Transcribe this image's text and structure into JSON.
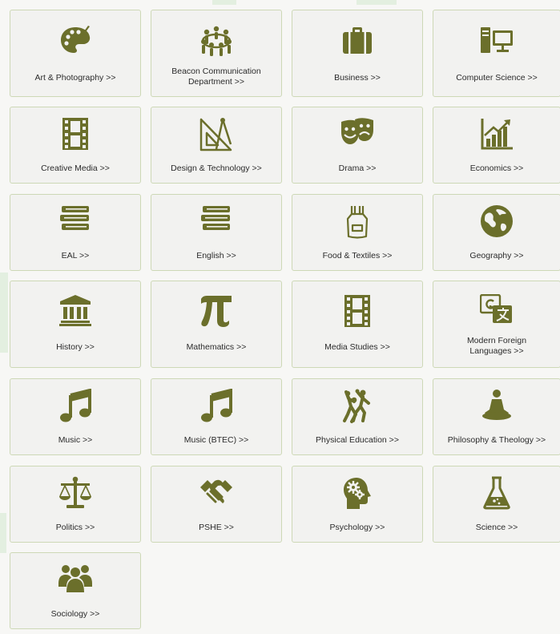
{
  "accent_color": "#6b6f2b",
  "border_color": "#cdd8b6",
  "subjects": [
    {
      "label": "Art & Photography >>",
      "icon": "palette-icon"
    },
    {
      "label": "Beacon Communication Department >>",
      "icon": "people-circle-icon"
    },
    {
      "label": "Business >>",
      "icon": "briefcase-icon"
    },
    {
      "label": "Computer Science >>",
      "icon": "computer-icon"
    },
    {
      "label": "Creative Media >>",
      "icon": "film-strip-icon"
    },
    {
      "label": "Design & Technology >>",
      "icon": "drafting-tools-icon"
    },
    {
      "label": "Drama >>",
      "icon": "theatre-masks-icon"
    },
    {
      "label": "Economics >>",
      "icon": "bar-chart-icon"
    },
    {
      "label": "EAL >>",
      "icon": "books-icon"
    },
    {
      "label": "English >>",
      "icon": "books-icon"
    },
    {
      "label": "Food & Textiles >>",
      "icon": "apron-icon"
    },
    {
      "label": "Geography >>",
      "icon": "globe-icon"
    },
    {
      "label": "History >>",
      "icon": "museum-icon"
    },
    {
      "label": "Mathematics >>",
      "icon": "pi-icon"
    },
    {
      "label": "Media Studies >>",
      "icon": "film-strip-icon"
    },
    {
      "label": "Modern Foreign Languages >>",
      "icon": "translate-icon"
    },
    {
      "label": "Music >>",
      "icon": "music-note-icon"
    },
    {
      "label": "Music (BTEC) >>",
      "icon": "music-note-icon"
    },
    {
      "label": "Physical Education >>",
      "icon": "basketball-players-icon"
    },
    {
      "label": "Philosophy & Theology >>",
      "icon": "meditation-icon"
    },
    {
      "label": "Politics >>",
      "icon": "scales-icon"
    },
    {
      "label": "PSHE >>",
      "icon": "handshake-icon"
    },
    {
      "label": "Psychology >>",
      "icon": "head-gears-icon"
    },
    {
      "label": "Science >>",
      "icon": "flask-icon"
    },
    {
      "label": "Sociology >>",
      "icon": "group-icon"
    }
  ]
}
